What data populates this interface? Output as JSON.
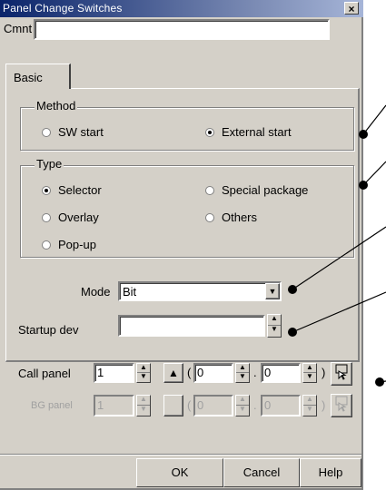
{
  "window": {
    "title": "Panel Change Switches",
    "close_glyph": "×"
  },
  "comment": {
    "label": "Cmnt",
    "value": ""
  },
  "tabs": [
    {
      "label": "Basic"
    }
  ],
  "method": {
    "legend": "Method",
    "options": [
      {
        "label": "SW start",
        "checked": false
      },
      {
        "label": "External start",
        "checked": true
      }
    ]
  },
  "type": {
    "legend": "Type",
    "options": [
      {
        "label": "Selector",
        "checked": true
      },
      {
        "label": "Special package",
        "checked": false
      },
      {
        "label": "Overlay",
        "checked": false
      },
      {
        "label": "Others",
        "checked": false
      },
      {
        "label": "Pop-up",
        "checked": false
      }
    ]
  },
  "mode": {
    "label": "Mode",
    "value": "Bit"
  },
  "startup": {
    "label": "Startup dev",
    "value": ""
  },
  "call_panel": {
    "label": "Call panel",
    "value": "1",
    "open_paren": "(",
    "x": "0",
    "dot": ".",
    "y": "0",
    "close_paren": ")"
  },
  "bg_panel": {
    "label": "BG panel",
    "value": "1",
    "open_paren": "(",
    "x": "0",
    "dot": ".",
    "y": "0",
    "close_paren": ")"
  },
  "footer": {
    "ok": "OK",
    "cancel": "Cancel",
    "help": "Help"
  },
  "colors": {
    "title_start": "#0a246a",
    "title_end": "#a6b5d8",
    "face": "#d4d0c8"
  },
  "icons": [
    "close-icon",
    "spin-up-icon",
    "spin-down-icon",
    "dropdown-arrow-icon",
    "triangle-icon",
    "pick-icon"
  ]
}
